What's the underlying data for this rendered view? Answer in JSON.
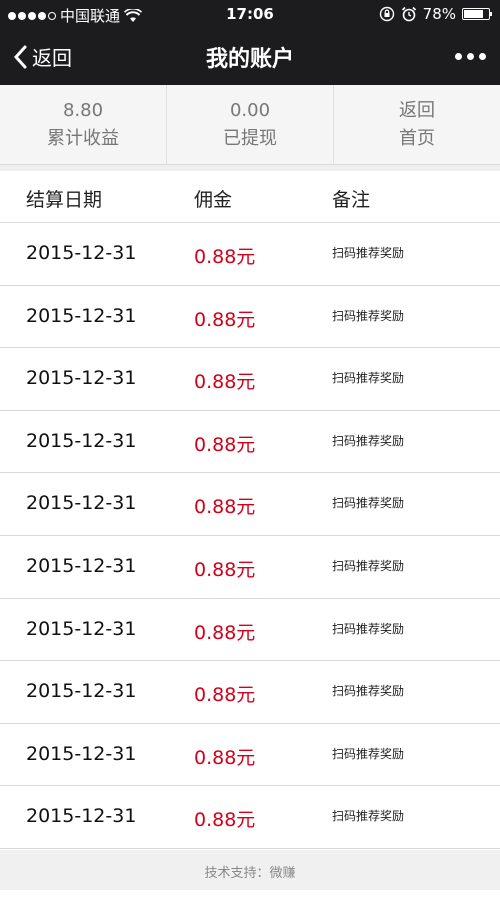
{
  "status_bar": {
    "carrier": "中国联通",
    "time": "17:06",
    "battery": "78%",
    "battery_level": 0.78
  },
  "nav": {
    "back_label": "返回",
    "title": "我的账户"
  },
  "summary": [
    {
      "value": "8.80",
      "label": "累计收益"
    },
    {
      "value": "0.00",
      "label": "已提现"
    },
    {
      "value": "返回",
      "label": "首页"
    }
  ],
  "table": {
    "headers": {
      "date": "结算日期",
      "amount": "佣金",
      "note": "备注"
    },
    "rows": [
      {
        "date": "2015-12-31",
        "amount": "0.88元",
        "note": "扫码推荐奖励"
      },
      {
        "date": "2015-12-31",
        "amount": "0.88元",
        "note": "扫码推荐奖励"
      },
      {
        "date": "2015-12-31",
        "amount": "0.88元",
        "note": "扫码推荐奖励"
      },
      {
        "date": "2015-12-31",
        "amount": "0.88元",
        "note": "扫码推荐奖励"
      },
      {
        "date": "2015-12-31",
        "amount": "0.88元",
        "note": "扫码推荐奖励"
      },
      {
        "date": "2015-12-31",
        "amount": "0.88元",
        "note": "扫码推荐奖励"
      },
      {
        "date": "2015-12-31",
        "amount": "0.88元",
        "note": "扫码推荐奖励"
      },
      {
        "date": "2015-12-31",
        "amount": "0.88元",
        "note": "扫码推荐奖励"
      },
      {
        "date": "2015-12-31",
        "amount": "0.88元",
        "note": "扫码推荐奖励"
      },
      {
        "date": "2015-12-31",
        "amount": "0.88元",
        "note": "扫码推荐奖励"
      }
    ]
  },
  "footer": {
    "text": "技术支持：微赚"
  },
  "colors": {
    "amount": "#d0021b",
    "bar": "#1c1c1e"
  }
}
